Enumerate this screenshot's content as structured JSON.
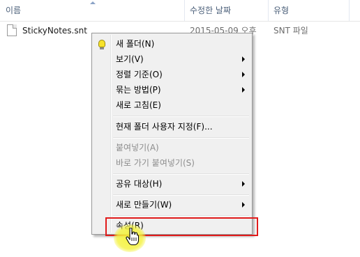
{
  "columns": {
    "name": "이름",
    "date_modified": "수정한 날짜",
    "type": "유형"
  },
  "file": {
    "name": "StickyNotes.snt",
    "date_modified": "2015-05-09 오후",
    "type": "SNT 파일"
  },
  "context_menu": {
    "items": [
      {
        "label": "새 폴더(N)",
        "icon": "lightbulb-icon",
        "submenu": false,
        "disabled": false
      },
      {
        "label": "보기(V)",
        "submenu": true,
        "disabled": false
      },
      {
        "label": "정렬 기준(O)",
        "submenu": true,
        "disabled": false
      },
      {
        "label": "묶는 방법(P)",
        "submenu": true,
        "disabled": false
      },
      {
        "label": "새로 고침(E)",
        "submenu": false,
        "disabled": false
      },
      {
        "label": "현재 폴더 사용자 지정(F)...",
        "submenu": false,
        "disabled": false
      },
      {
        "label": "붙여넣기(A)",
        "submenu": false,
        "disabled": true
      },
      {
        "label": "바로 가기 붙여넣기(S)",
        "submenu": false,
        "disabled": true
      },
      {
        "label": "공유 대상(H)",
        "submenu": true,
        "disabled": false
      },
      {
        "label": "새로 만들기(W)",
        "submenu": true,
        "disabled": false
      },
      {
        "label": "속성(R)",
        "submenu": false,
        "disabled": false,
        "highlighted": true
      }
    ]
  },
  "colors": {
    "highlight_border": "#e11b1b",
    "cursor_halo": "#f4f23c",
    "menu_background": "#f0f0f0"
  }
}
